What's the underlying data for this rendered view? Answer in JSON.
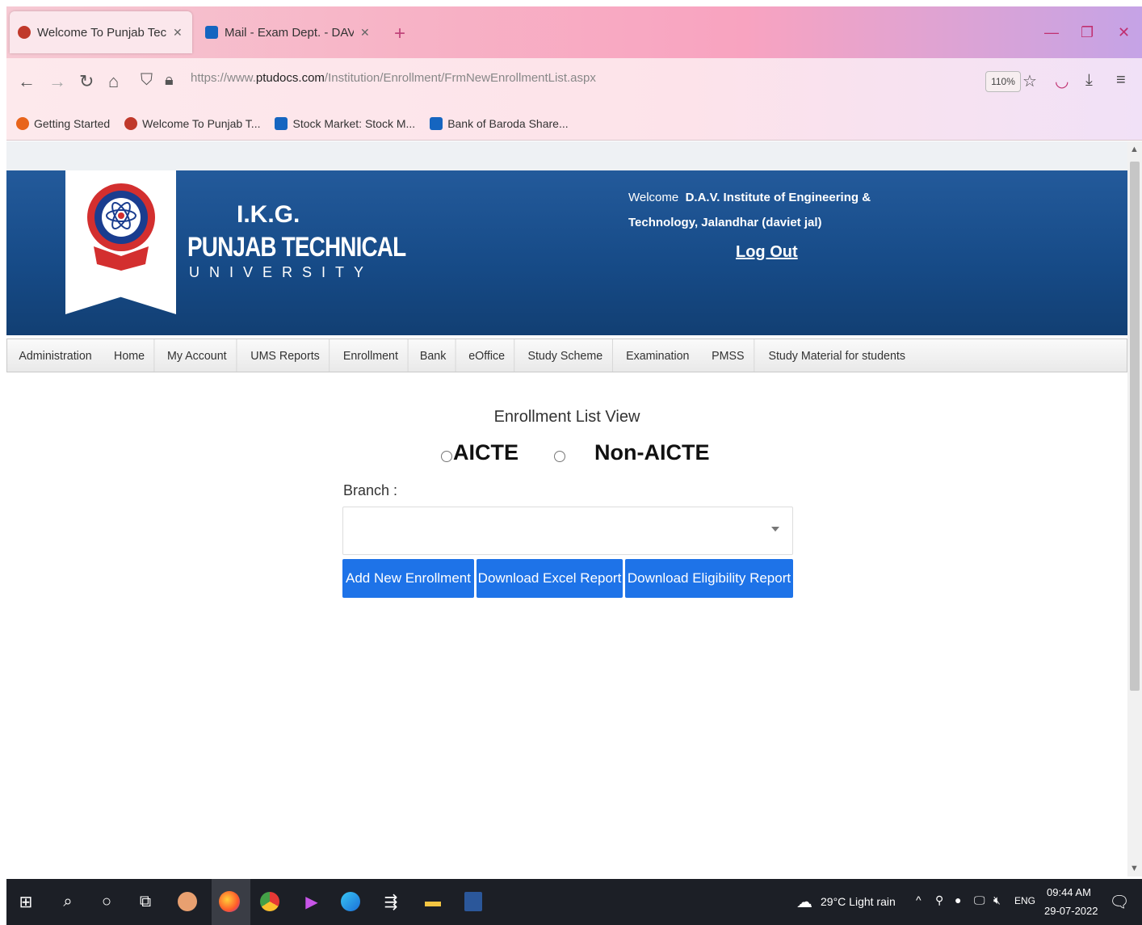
{
  "browser": {
    "tabs": [
      {
        "label": "Welcome To Punjab Technical U",
        "active": true
      },
      {
        "label": "Mail - Exam Dept. - DAVIET - O",
        "active": false
      }
    ],
    "url_prefix": "https://www.",
    "url_domain": "ptudocs.com",
    "url_path": "/Institution/Enrollment/FrmNewEnrollmentList.aspx",
    "zoom": "110%",
    "bookmarks": [
      "Getting Started",
      "Welcome To Punjab T...",
      "Stock Market: Stock M...",
      "Bank of Baroda Share..."
    ]
  },
  "header": {
    "uni_line1": "I.K.G.",
    "uni_line2": "PUNJAB TECHNICAL",
    "uni_line3": "UNIVERSITY",
    "welcome_word": "Welcome",
    "institute_line1": "D.A.V.  Institute  of  Engineering  &",
    "institute_line2": "Technology, Jalandhar (daviet jal)",
    "logout": "Log Out"
  },
  "menu": [
    "Administration",
    "Home",
    "My Account",
    "UMS Reports",
    "Enrollment",
    "Bank",
    "eOffice",
    "Study Scheme",
    "Examination",
    "PMSS",
    "Study Material for students"
  ],
  "main": {
    "title": "Enrollment List View",
    "radio_aicte": "AICTE",
    "radio_non_aicte": "Non-AICTE",
    "branch_label": "Branch :",
    "branch_value": "",
    "buttons": {
      "add": "Add New Enrollment",
      "excel": "Download Excel Report",
      "eligibility": "Download Eligibility Report"
    }
  },
  "taskbar": {
    "weather": "29°C  Light rain",
    "lang": "ENG",
    "time": "09:44 AM",
    "date": "29-07-2022"
  },
  "colors": {
    "banner": "#164a86",
    "button": "#1e73e8",
    "tabbar": "#f8a3c0"
  }
}
